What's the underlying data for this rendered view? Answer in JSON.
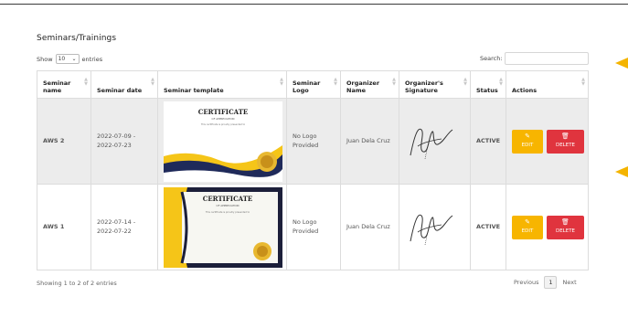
{
  "page": {
    "title": "Seminars/Trainings"
  },
  "length_control": {
    "show_label": "Show",
    "selected": "10",
    "entries_label": "entries"
  },
  "search": {
    "label": "Search:",
    "value": ""
  },
  "table": {
    "headers": [
      "Seminar name",
      "Seminar date",
      "Seminar template",
      "Seminar Logo",
      "Organizer Name",
      "Organizer's Signature",
      "Status",
      "Actions"
    ],
    "rows": [
      {
        "name": "AWS 2",
        "date_start": "2022-07-09 -",
        "date_end": "2022-07-23",
        "cert_title": "CERTIFICATE",
        "cert_sub": "OF APPRECIATION",
        "cert_body": "This certificate is proudly presented to",
        "logo_line1": "No Logo",
        "logo_line2": "Provided",
        "organizer": "Juan Dela Cruz",
        "status": "ACTIVE",
        "edit_label": "EDIT",
        "delete_label": "DELETE"
      },
      {
        "name": "AWS 1",
        "date_start": "2022-07-14 -",
        "date_end": "2022-07-22",
        "cert_title": "CERTIFICATE",
        "cert_sub": "OF APPRECIATION",
        "cert_body": "This certificate is proudly presented to",
        "logo_line1": "No Logo",
        "logo_line2": "Provided",
        "organizer": "Juan Dela Cruz",
        "status": "ACTIVE",
        "edit_label": "EDIT",
        "delete_label": "DELETE"
      }
    ]
  },
  "footer": {
    "info": "Showing 1 to 2 of 2 entries",
    "previous": "Previous",
    "page": "1",
    "next": "Next"
  },
  "icons": {
    "edit": "pencil-icon",
    "delete": "trash-icon",
    "sort": "sort-icon",
    "select": "chevron-down-icon",
    "annotation": "arrow-left-icon"
  },
  "colors": {
    "edit": "#f7b500",
    "delete": "#e0343e",
    "active": "#28a745",
    "no_logo": "#d9363e",
    "arrow": "#f4b400"
  }
}
